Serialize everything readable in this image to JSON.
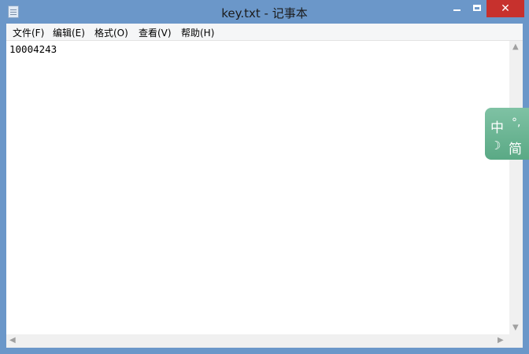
{
  "window": {
    "title": "key.txt - 记事本",
    "close_glyph": "✕"
  },
  "menu": [
    "文件(F)",
    "编辑(E)",
    "格式(O)",
    "查看(V)",
    "帮助(H)"
  ],
  "editor": {
    "content": "10004243"
  },
  "ime": {
    "mode": "中",
    "punct": "°,",
    "theme": "☽",
    "script": "简"
  }
}
